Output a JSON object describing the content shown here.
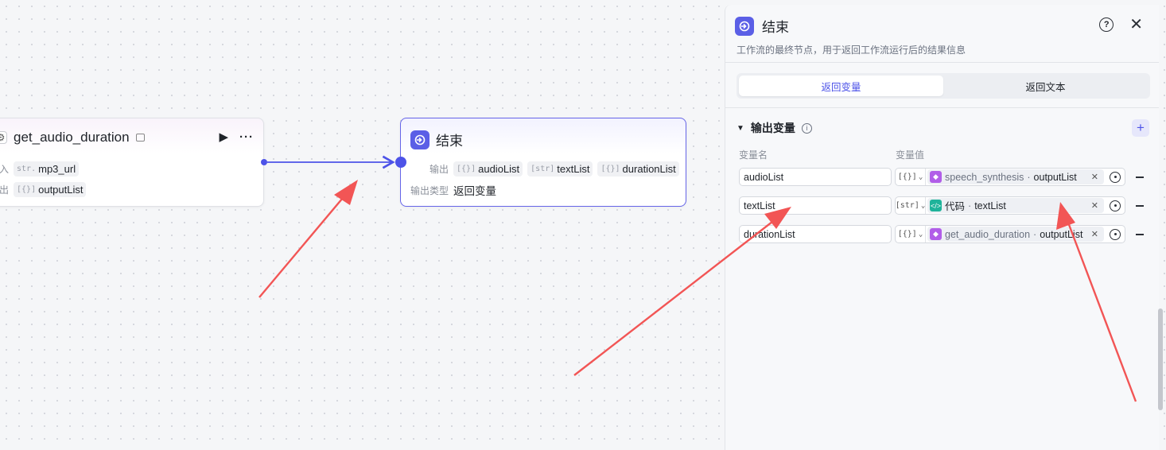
{
  "canvas": {
    "audio_node": {
      "title": "get_audio_duration",
      "input_label": "入",
      "input_type": "str.",
      "input_value": "mp3_url",
      "output_label": "出",
      "output_type": "[{}]",
      "output_value": "outputList"
    },
    "end_node": {
      "title": "结束",
      "output_label": "输出",
      "outputs": [
        {
          "type": "[{}]",
          "name": "audioList"
        },
        {
          "type": "[str]",
          "name": "textList"
        },
        {
          "type": "[{}]",
          "name": "durationList"
        }
      ],
      "output_type_label": "输出类型",
      "output_type_value": "返回变量"
    }
  },
  "panel": {
    "title": "结束",
    "description": "工作流的最终节点，用于返回工作流运行后的结果信息",
    "tabs": [
      {
        "label": "返回变量",
        "active": true
      },
      {
        "label": "返回文本",
        "active": false
      }
    ],
    "section_title": "输出变量",
    "col_name": "变量名",
    "col_value": "变量值",
    "rows": [
      {
        "name": "audioList",
        "type": "[{}]",
        "node": "speech_synthesis",
        "sep": " · ",
        "field": "outputList",
        "icon_color": "#b15ee8"
      },
      {
        "name": "textList",
        "type": "[str]",
        "node": "代码",
        "sep": " · ",
        "field": "textList",
        "icon_color": "#1fb39a"
      },
      {
        "name": "durationList",
        "type": "[{}]",
        "node": "get_audio_duration",
        "sep": " · ",
        "field": "outputList",
        "icon_color": "#b15ee8"
      }
    ]
  },
  "colors": {
    "accent": "#4d53e8",
    "arrow": "#f25555"
  }
}
